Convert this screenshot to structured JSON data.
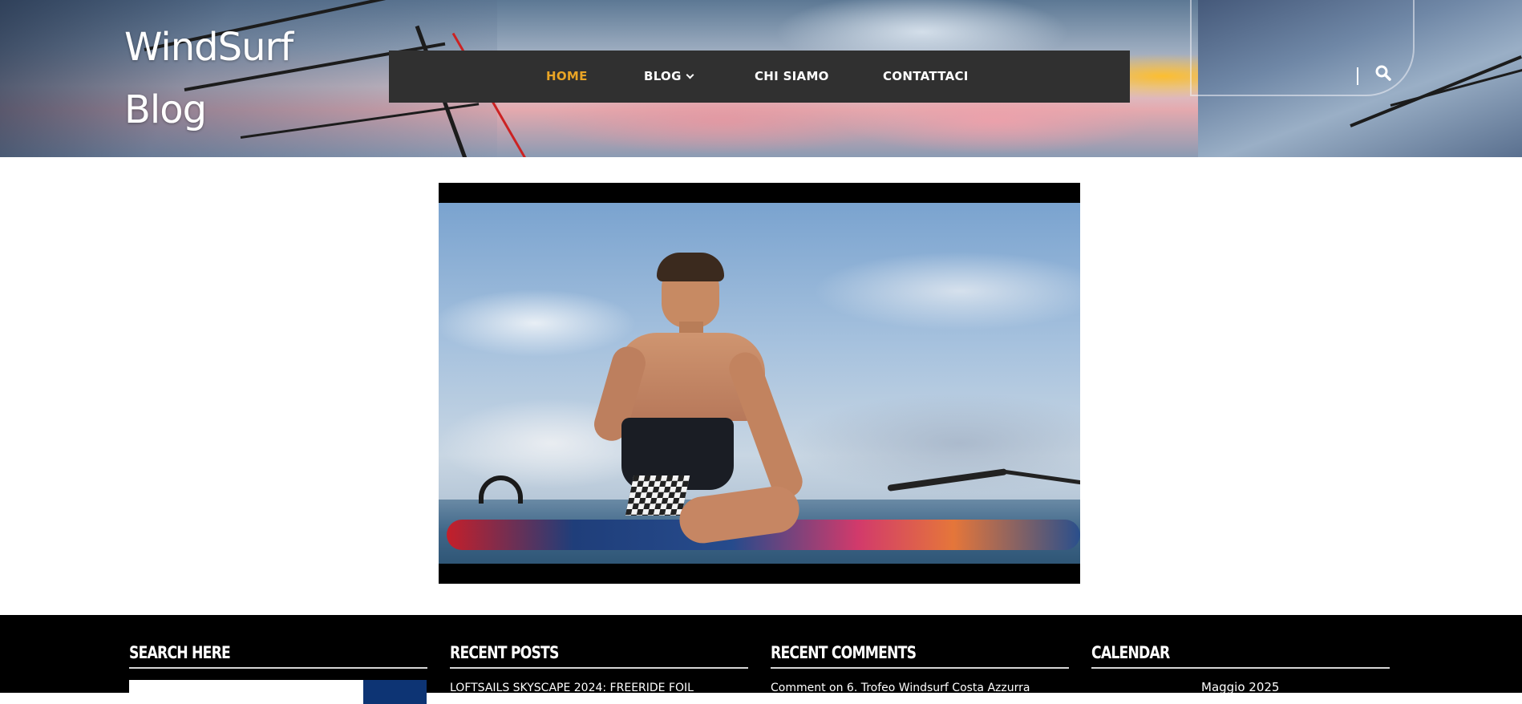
{
  "site": {
    "title": "WindSurf Blog"
  },
  "nav": {
    "items": [
      {
        "label": "HOME",
        "active": true
      },
      {
        "label": "BLOG",
        "has_dropdown": true
      },
      {
        "label": "CHI SIAMO"
      },
      {
        "label": "CONTATTACI"
      }
    ]
  },
  "header": {
    "search_icon": "search-icon"
  },
  "colors": {
    "nav_bg": "#303030",
    "nav_active": "#e9a425",
    "footer_bg": "#000000",
    "search_button": "#0d3474"
  },
  "footer": {
    "widgets": [
      {
        "title": "SEARCH HERE"
      },
      {
        "title": "RECENT POSTS",
        "items": [
          "LOFTSAILS SKYSCAPE 2024: FREERIDE FOIL"
        ]
      },
      {
        "title": "RECENT COMMENTS",
        "items": [
          "Comment on 6. Trofeo Windsurf Costa Azzurra"
        ]
      },
      {
        "title": "CALENDAR",
        "month": "Maggio 2025"
      }
    ]
  }
}
